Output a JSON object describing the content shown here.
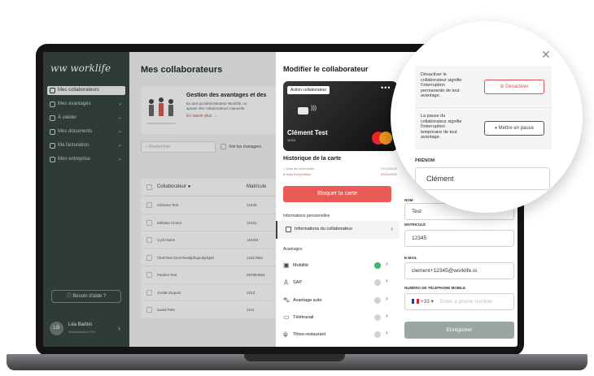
{
  "sidebar": {
    "logo": "worklife",
    "items": [
      {
        "label": "Mes collaborateurs",
        "icon": "people-icon"
      },
      {
        "label": "Mes avantages",
        "icon": "grid-icon"
      },
      {
        "label": "À valider",
        "icon": "check-icon"
      },
      {
        "label": "Mes documents",
        "icon": "folder-icon"
      },
      {
        "label": "Ma facturation",
        "icon": "invoice-icon"
      },
      {
        "label": "Mon entreprise",
        "icon": "building-icon"
      }
    ],
    "help": "Besoin d'aide ?",
    "user": {
      "initials": "LB",
      "name": "Léa Barbio",
      "role": "Administrateur RH"
    }
  },
  "main": {
    "title": "Mes collaborateurs",
    "banner": {
      "title": "Gestion des avantages et des",
      "text1": "En tant qu'administrateur Worklife, vo",
      "text2": "ajouter des collaborateurs manuelle",
      "link": "En savoir plus →"
    },
    "search_placeholder": "Rechercher",
    "managers_label": "Voir les managers",
    "columns": [
      "Collaborateur",
      "Matricule"
    ],
    "rows": [
      {
        "name": "Clément Test",
        "id": "12345"
      },
      {
        "name": "Mélanie Clonet",
        "id": "12321"
      },
      {
        "name": "Cyril Haine",
        "id": "122331"
      },
      {
        "name": "ClemTest ClemTestalphajouhjdsjdn",
        "id": "12317682"
      },
      {
        "name": "Pauline Test",
        "id": "097654564"
      },
      {
        "name": "Jordan Dupuis",
        "id": "4313"
      },
      {
        "name": "David Petit",
        "id": "1211"
      }
    ]
  },
  "drawer": {
    "title": "Modifier le collaborateur",
    "card": {
      "tag": "Action collaborateur",
      "name": "Clément Test",
      "expiry": "12/24"
    },
    "history_title": "Historique de la carte",
    "history": [
      {
        "label": "Date de commande",
        "date": "07/10/2022",
        "color": "#8a8a8a"
      },
      {
        "label": "Date d'expédition",
        "date": "09/10/2022",
        "color": "#e0544f"
      }
    ],
    "block_button": "Bloquer la carte",
    "personal_label": "Informations personnelles",
    "personal_item": "Informations du collaborateur",
    "benefits_label": "Avantages",
    "benefits": [
      {
        "label": "Mobilité",
        "icon": "bus-icon",
        "active": true
      },
      {
        "label": "SAP",
        "icon": "person-icon",
        "active": false
      },
      {
        "label": "Avantage auto",
        "icon": "car-icon",
        "active": false
      },
      {
        "label": "Télétravail",
        "icon": "laptop-icon",
        "active": false
      },
      {
        "label": "Titres-restaurant",
        "icon": "fork-icon",
        "active": false
      }
    ]
  },
  "form": {
    "nom_label": "NOM",
    "nom_value": "Test",
    "matricule_label": "MATRICULE",
    "matricule_value": "12345",
    "email_label": "E-MAIL",
    "email_value": "clement+12345@worklife.io",
    "phone_label": "NUMÉRO DE TÉLÉPHONE MOBILE",
    "phone_code": "+33",
    "phone_placeholder": "Enter a phone number",
    "save": "Enregistrer"
  },
  "bubble": {
    "deactivate_text": "Désactiver le collaborateur signifie l'interruption permanente de tout avantage.",
    "deactivate_button": "Désactiver",
    "pause_text": "La pause du collaborateur signifie l'interruption temporaire de tout avantage.",
    "pause_button": "Mettre en pause",
    "prenom_label": "PRÉNOM",
    "prenom_value": "Clément"
  }
}
